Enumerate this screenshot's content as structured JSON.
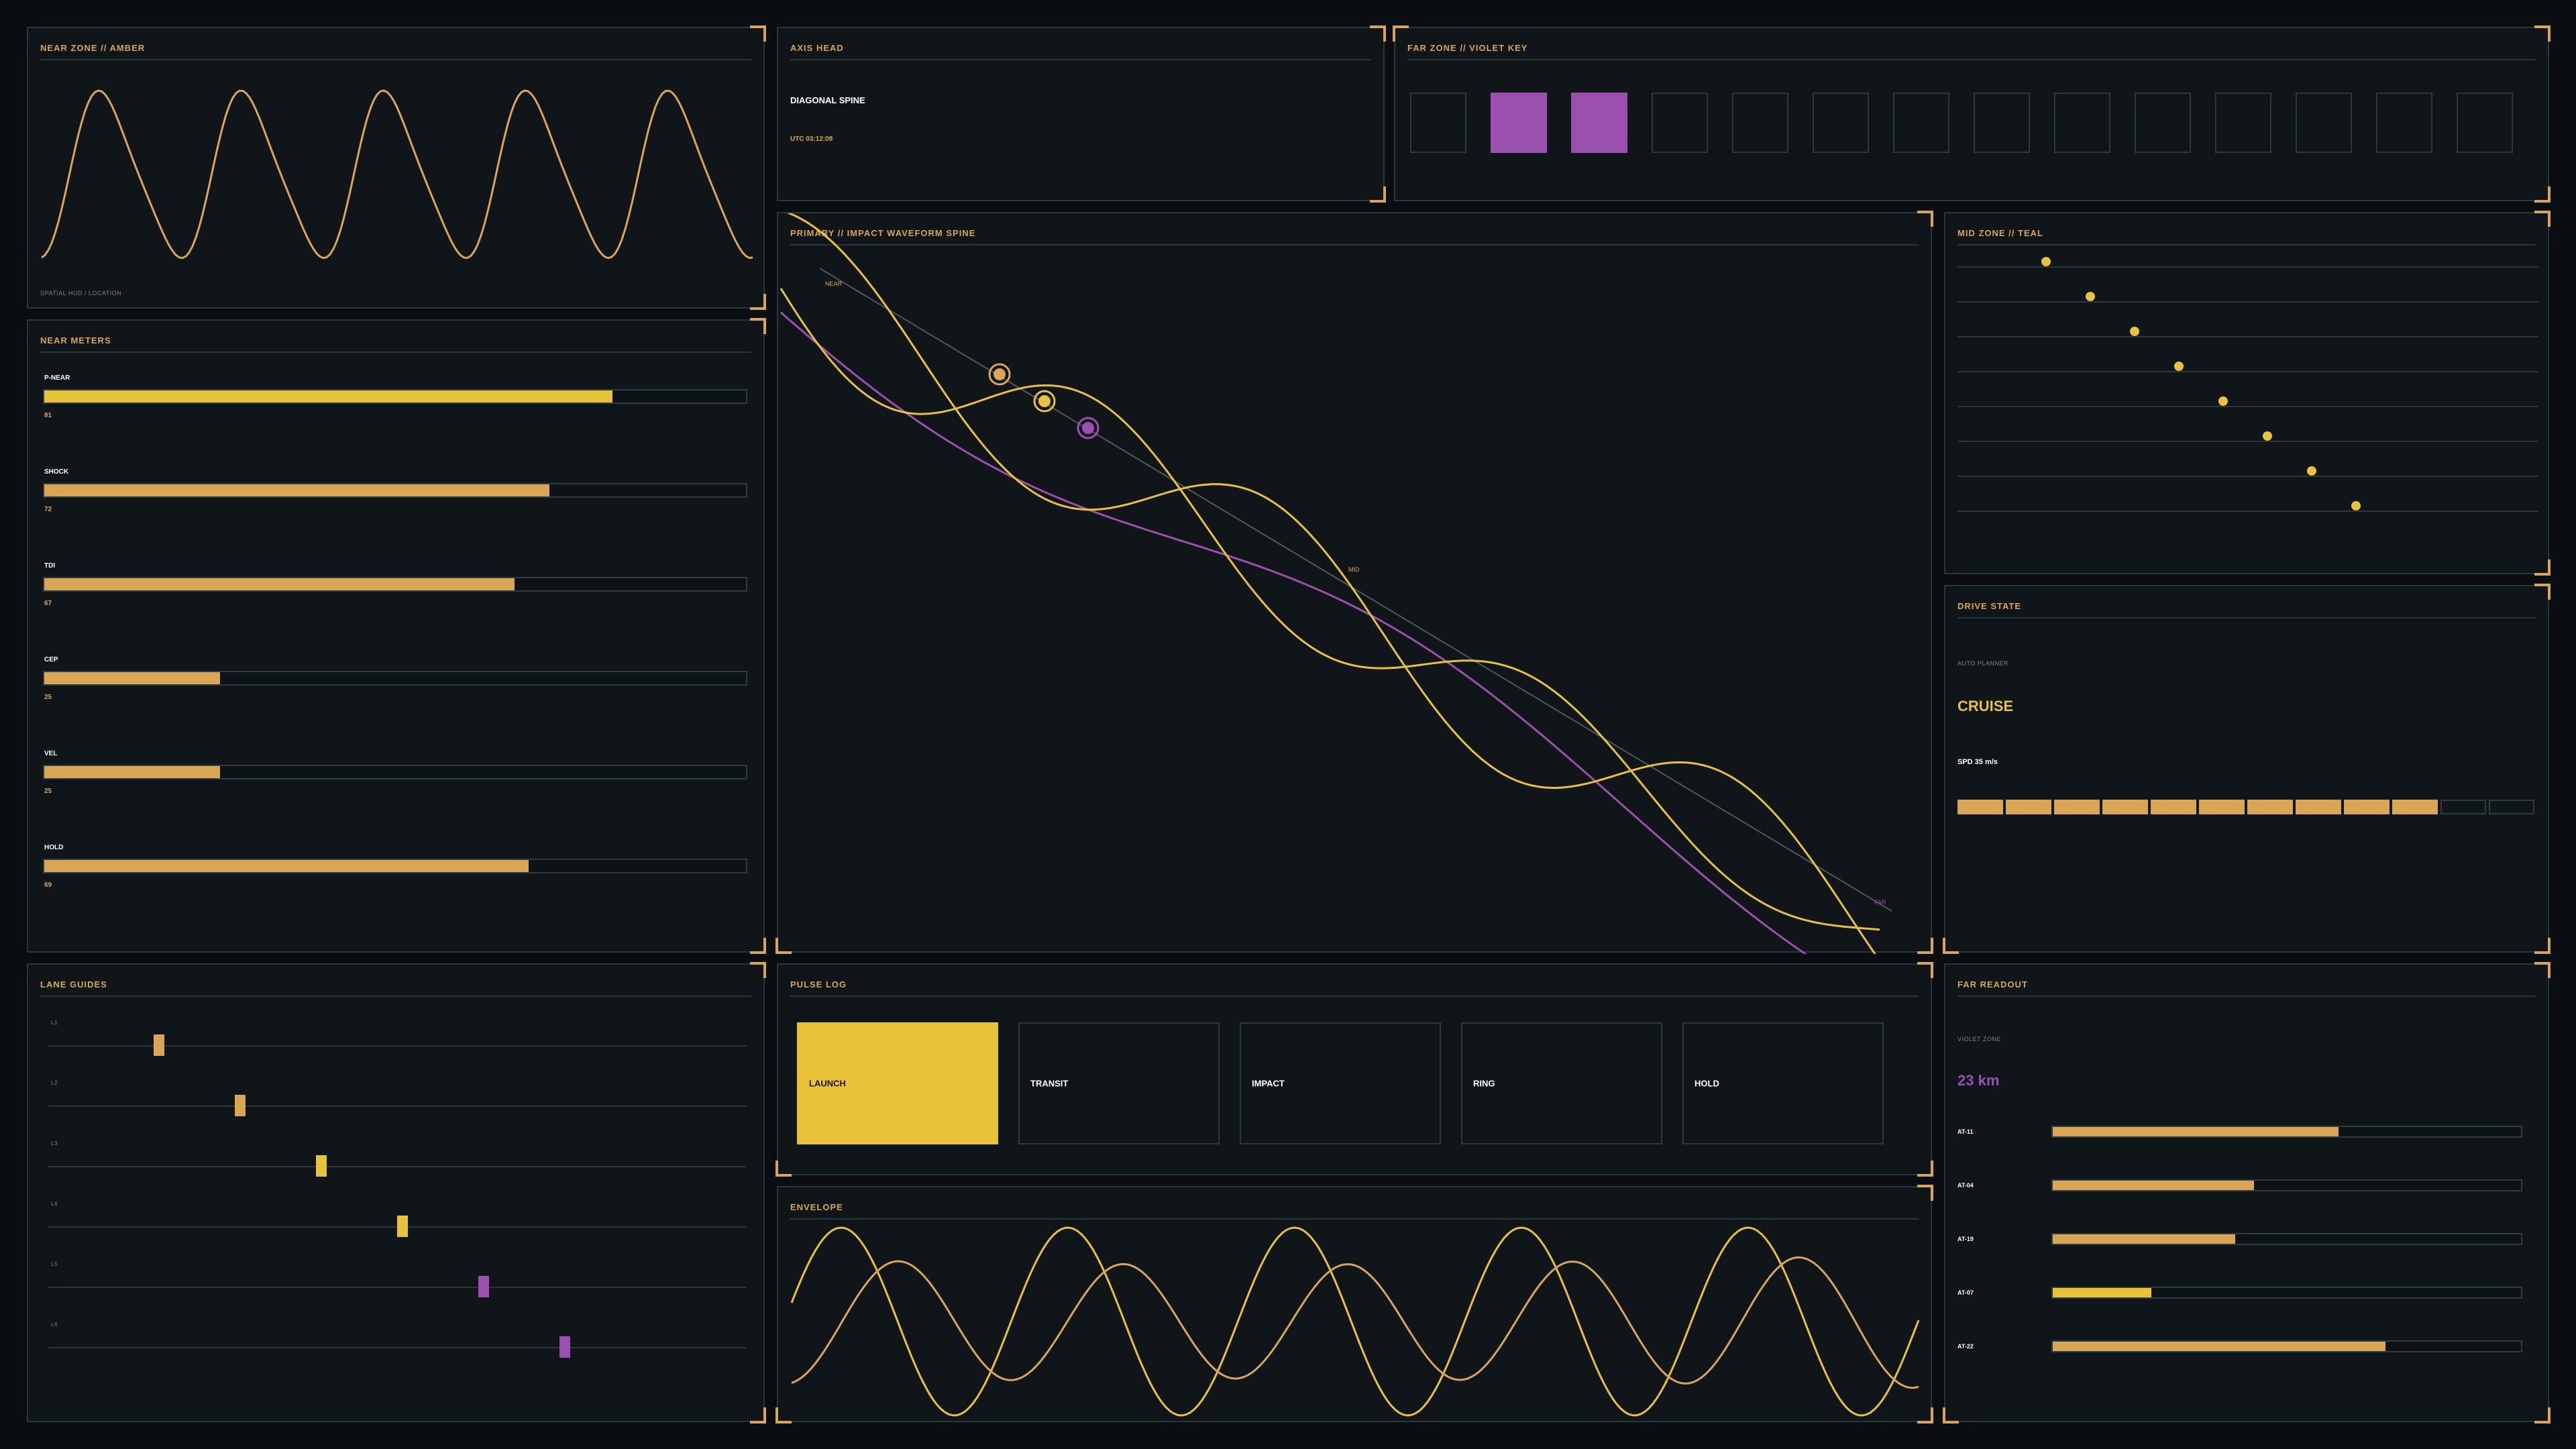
{
  "near_zone": {
    "title": "NEAR ZONE  //  AMBER",
    "footer": "SPATIAL HUD / LOCATION"
  },
  "axis_head": {
    "title": "AXIS HEAD",
    "name": "DIAGONAL SPINE",
    "utc": "UTC 03:12:08"
  },
  "far_zone": {
    "title": "FAR ZONE  //  VIOLET KEY",
    "cells": [
      false,
      true,
      true,
      false,
      false,
      false,
      false,
      false,
      false,
      false,
      false,
      false,
      false,
      false
    ]
  },
  "primary": {
    "title": "PRIMARY  //  IMPACT WAVEFORM SPINE",
    "near_label": "NEAR",
    "mid_label": "MID",
    "far_label": "FAR"
  },
  "mid_zone": {
    "title": "MID ZONE  //  TEAL",
    "points": 8
  },
  "near_meters": {
    "title": "NEAR METERS",
    "items": [
      {
        "label": "P-NEAR",
        "value": "81",
        "pct": 81,
        "color": "#e8c33a"
      },
      {
        "label": "SHOCK",
        "value": "72",
        "pct": 72,
        "color": "#d9a655"
      },
      {
        "label": "TDI",
        "value": "67",
        "pct": 67,
        "color": "#d9a655"
      },
      {
        "label": "CEP",
        "value": "25",
        "pct": 25,
        "color": "#d9a655"
      },
      {
        "label": "VEL",
        "value": "25",
        "pct": 25,
        "color": "#d9a655"
      },
      {
        "label": "HOLD",
        "value": "69",
        "pct": 69,
        "color": "#d9a655"
      }
    ]
  },
  "drive_state": {
    "title": "DRIVE STATE",
    "sub": "AUTO PLANNER",
    "state": "CRUISE",
    "speed": "SPD 35 m/s",
    "segments_on": 10,
    "segments_total": 12
  },
  "lane_guides": {
    "title": "LANE GUIDES",
    "lanes": [
      {
        "label": "L1",
        "pos": 0.17,
        "color": "#d9a655"
      },
      {
        "label": "L2",
        "pos": 0.28,
        "color": "#d9a655"
      },
      {
        "label": "L3",
        "pos": 0.39,
        "color": "#e8c33a"
      },
      {
        "label": "L4",
        "pos": 0.5,
        "color": "#e8c33a"
      },
      {
        "label": "L5",
        "pos": 0.61,
        "color": "#9b4fae"
      },
      {
        "label": "L6",
        "pos": 0.72,
        "color": "#9b4fae"
      }
    ]
  },
  "pulse_log": {
    "title": "PULSE LOG",
    "items": [
      "LAUNCH",
      "TRANSIT",
      "IMPACT",
      "RING",
      "HOLD"
    ],
    "active": 0
  },
  "envelope": {
    "title": "ENVELOPE"
  },
  "far_readout": {
    "title": "FAR READOUT",
    "sub": "VIOLET ZONE",
    "distance": "23 km",
    "items": [
      {
        "label": "AT-11",
        "pct": 61,
        "color": "#d9a655"
      },
      {
        "label": "AT-04",
        "pct": 43,
        "color": "#d9a655"
      },
      {
        "label": "AT-19",
        "pct": 39,
        "color": "#d9a655"
      },
      {
        "label": "AT-07",
        "pct": 21,
        "color": "#e8c33a"
      },
      {
        "label": "AT-22",
        "pct": 71,
        "color": "#d9a655"
      }
    ]
  },
  "colors": {
    "amber": "#d9a655",
    "yellow": "#e8c33a",
    "violet": "#9b4fae",
    "line": "#27373c"
  }
}
